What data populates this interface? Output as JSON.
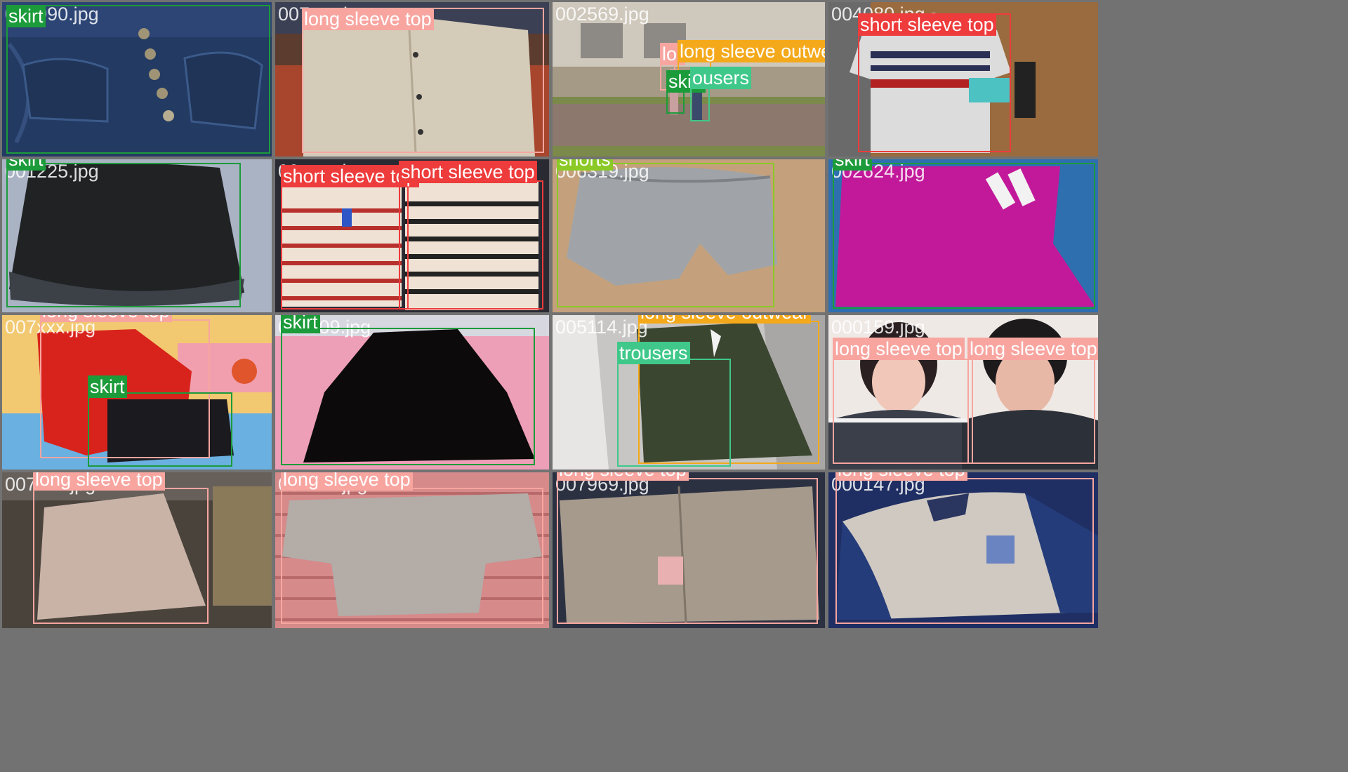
{
  "classes": {
    "skirt": "#1c9b3a",
    "long sleeve top": "#f8a5a0",
    "short sleeve top": "#ee3b3b",
    "long sleeve outwear": "#f4a91b",
    "trousers": "#3fc88a",
    "shorts": "#8ac926"
  },
  "tiles": [
    {
      "filename": "001990.jpg",
      "icon": "denim-skirt-photo"
    },
    {
      "filename": "007xxx.jpg",
      "icon": "beige-jacket-photo"
    },
    {
      "filename": "002569.jpg",
      "icon": "outdoor-people-photo"
    },
    {
      "filename": "004080.jpg",
      "icon": "striped-tshirt-photo"
    },
    {
      "filename": "001225.jpg",
      "icon": "black-skirt-photo"
    },
    {
      "filename": "00xxxx.jpg",
      "icon": "two-striped-tshirts-photo"
    },
    {
      "filename": "006319.jpg",
      "icon": "grey-shorts-photo"
    },
    {
      "filename": "002624.jpg",
      "icon": "magenta-skirt-photo"
    },
    {
      "filename": "007xxx.jpg",
      "icon": "red-cardigan-photo"
    },
    {
      "filename": "00x909.jpg",
      "icon": "black-flared-skirt-photo"
    },
    {
      "filename": "005114.jpg",
      "icon": "olive-jacket-photo"
    },
    {
      "filename": "000159.jpg",
      "icon": "selfie-photo"
    },
    {
      "filename": "007xxx.jpg",
      "icon": "beige-shirt-photo"
    },
    {
      "filename": "00xxxx.jpg",
      "icon": "grey-sweater-photo"
    },
    {
      "filename": "007969.jpg",
      "icon": "khaki-shirt-photo"
    },
    {
      "filename": "000147.jpg",
      "icon": "baseball-jacket-photo"
    }
  ],
  "labels": [
    "skirt",
    "long sleeve top",
    "lor",
    "long sleeve outwear",
    "skirt",
    "ousers",
    "short sleeve top",
    "skirt",
    "short sleeve top",
    "short sleeve top",
    "shorts",
    "skirt",
    "long sleeve top",
    "skirt",
    "skirt",
    "long sleeve outwear",
    "trousers",
    "long sleeve top",
    "long sleeve top",
    "long sleeve top",
    "long sleeve top",
    "long sleeve top",
    "long sleeve top"
  ]
}
